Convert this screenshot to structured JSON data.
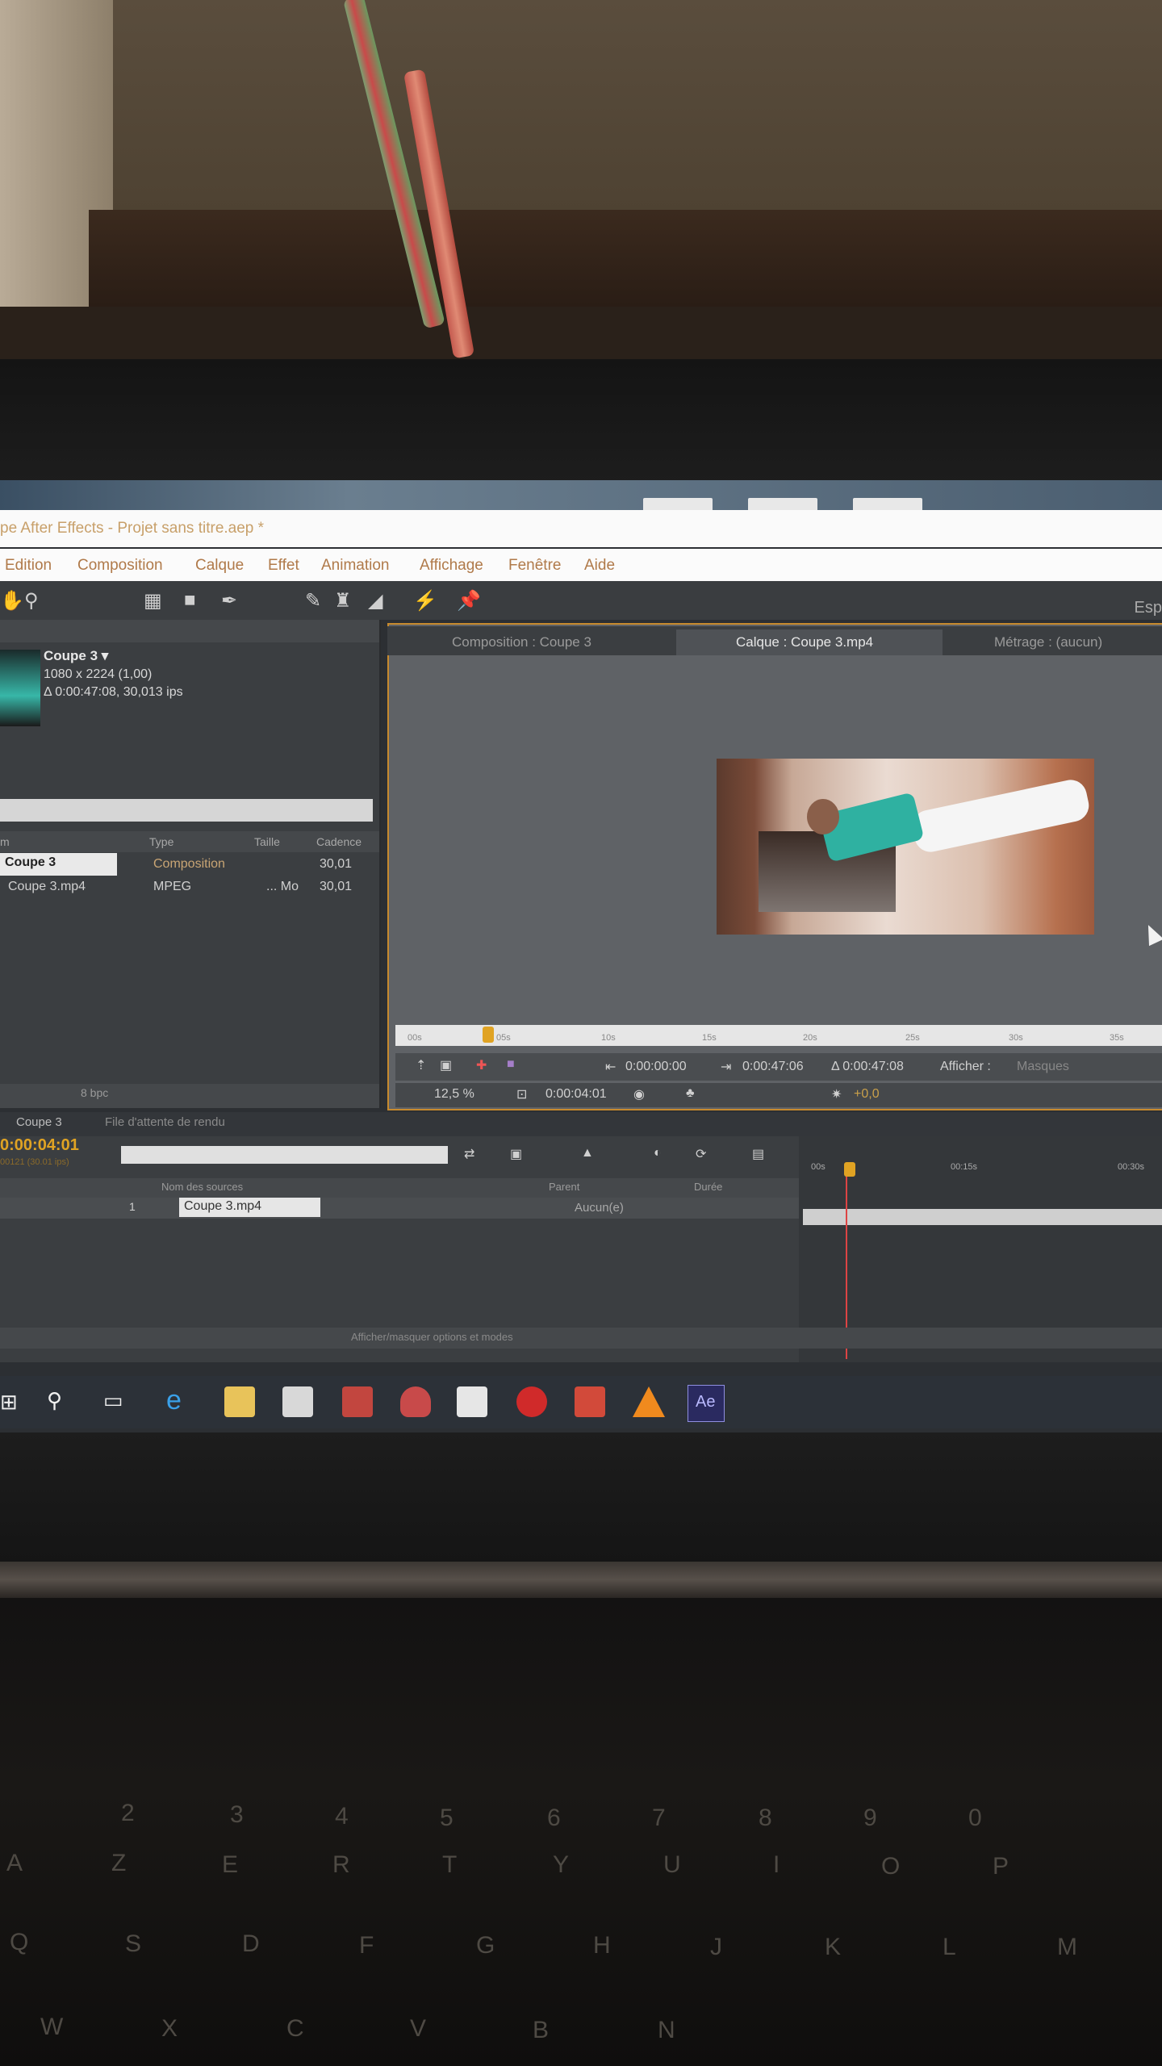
{
  "window": {
    "title": "pe After Effects - Projet sans titre.aep *",
    "workspace_label": "Esp"
  },
  "menu": [
    "Edition",
    "Composition",
    "Calque",
    "Effet",
    "Animation",
    "Affichage",
    "Fenêtre",
    "Aide"
  ],
  "project": {
    "item_name": "Coupe 3 ▾",
    "dimensions": "1080 x 2224 (1,00)",
    "duration": "Δ 0:00:47:08, 30,013 ips",
    "columns": {
      "name": "m",
      "type": "Type",
      "size": "Taille",
      "rate": "Cadence"
    },
    "rows": [
      {
        "name": "Coupe 3",
        "type": "Composition",
        "size": "",
        "rate": "30,01"
      },
      {
        "name": "Coupe 3.mp4",
        "type": "MPEG",
        "size": "... Mo",
        "rate": "30,01"
      }
    ],
    "bpc": "8 bpc"
  },
  "viewer": {
    "tabs": {
      "composition": "Composition : Coupe 3",
      "layer": "Calque : Coupe 3.mp4",
      "footage": "Métrage : (aucun)"
    },
    "ruler_ticks": [
      "00s",
      "05s",
      "10s",
      "15s",
      "20s",
      "25s",
      "30s",
      "35s"
    ],
    "in_point": "0:00:00:00",
    "out_point": "0:00:47:06",
    "duration": "Δ 0:00:47:08",
    "show_label": "Afficher :",
    "show_value": "Masques",
    "zoom": "12,5 %",
    "current_time": "0:00:04:01",
    "exposure": "+0,0"
  },
  "timeline": {
    "tabs": [
      "Coupe 3",
      "File d'attente de rendu"
    ],
    "timecode": "0:00:04:01",
    "timecode_sub": "00121 (30.01 ips)",
    "col_source": "Nom des sources",
    "col_parent": "Parent",
    "col_duration": "Durée",
    "layer_index": "1",
    "layer_name": "Coupe 3.mp4",
    "parent_value": "Aucun(e)",
    "ruler": [
      "00s",
      "00:15s",
      "00:30s"
    ],
    "footer": "Afficher/masquer options et modes"
  },
  "taskbar": [
    "windows-icon",
    "search-icon",
    "task-view-icon",
    "edge-icon",
    "explorer-icon",
    "store-icon",
    "app-red-icon",
    "shield-icon",
    "mail-icon",
    "opera-icon",
    "app-office-icon",
    "vlc-icon",
    "after-effects-icon"
  ],
  "taskbar_ae_label": "Ae",
  "keyboard": {
    "row_numbers": [
      "2",
      "3",
      "4",
      "5",
      "6",
      "7",
      "8",
      "9",
      "0"
    ],
    "row1": [
      "A",
      "Z",
      "E",
      "R",
      "T",
      "Y",
      "U",
      "I",
      "O",
      "P"
    ],
    "row2": [
      "Q",
      "S",
      "D",
      "F",
      "G",
      "H",
      "J",
      "K",
      "L",
      "M"
    ],
    "row3": [
      "W",
      "X",
      "C",
      "V",
      "B",
      "N"
    ]
  },
  "colors": {
    "accent_orange": "#e0a323",
    "panel": "#3b3e41",
    "viewer_bg": "#5f6266",
    "viewer_border": "#c78a2e"
  }
}
